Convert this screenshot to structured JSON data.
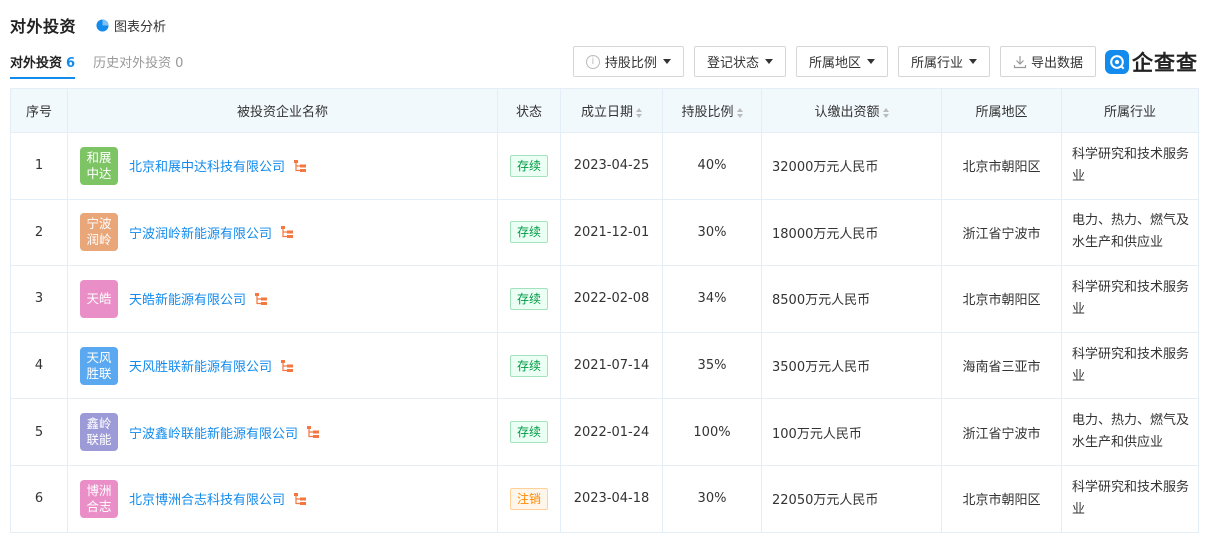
{
  "header": {
    "title": "对外投资",
    "chart_link": "图表分析"
  },
  "tabs": [
    {
      "label": "对外投资",
      "count": "6"
    },
    {
      "label": "历史对外投资",
      "count": "0"
    }
  ],
  "toolbar": {
    "share_ratio": "持股比例",
    "reg_status": "登记状态",
    "region": "所属地区",
    "industry": "所属行业",
    "export": "导出数据"
  },
  "brand": {
    "name": "企查查"
  },
  "colors": {
    "accent": "#128bed",
    "status_ok": "#009944",
    "status_cancel": "#ff8900"
  },
  "table": {
    "columns": {
      "index": "序号",
      "name": "被投资企业名称",
      "status": "状态",
      "date": "成立日期",
      "ratio": "持股比例",
      "capital": "认缴出资额",
      "region": "所属地区",
      "industry": "所属行业"
    },
    "rows": [
      {
        "index": "1",
        "avatar": "和展中达",
        "avatar_color": "#7dc465",
        "name": "北京和展中达科技有限公司",
        "status": "存续",
        "status_type": "ok",
        "date": "2023-04-25",
        "ratio": "40%",
        "capital": "32000万元人民币",
        "region": "北京市朝阳区",
        "industry": "科学研究和技术服务业"
      },
      {
        "index": "2",
        "avatar": "宁波润岭",
        "avatar_color": "#e8a679",
        "name": "宁波润岭新能源有限公司",
        "status": "存续",
        "status_type": "ok",
        "date": "2021-12-01",
        "ratio": "30%",
        "capital": "18000万元人民币",
        "region": "浙江省宁波市",
        "industry": "电力、热力、燃气及水生产和供应业"
      },
      {
        "index": "3",
        "avatar": "天皓",
        "avatar_color": "#ea8ec7",
        "name": "天皓新能源有限公司",
        "status": "存续",
        "status_type": "ok",
        "date": "2022-02-08",
        "ratio": "34%",
        "capital": "8500万元人民币",
        "region": "北京市朝阳区",
        "industry": "科学研究和技术服务业"
      },
      {
        "index": "4",
        "avatar": "天风胜联",
        "avatar_color": "#5aa9f0",
        "name": "天风胜联新能源有限公司",
        "status": "存续",
        "status_type": "ok",
        "date": "2021-07-14",
        "ratio": "35%",
        "capital": "3500万元人民币",
        "region": "海南省三亚市",
        "industry": "科学研究和技术服务业"
      },
      {
        "index": "5",
        "avatar": "鑫岭联能",
        "avatar_color": "#9d9ad8",
        "name": "宁波鑫岭联能新能源有限公司",
        "status": "存续",
        "status_type": "ok",
        "date": "2022-01-24",
        "ratio": "100%",
        "capital": "100万元人民币",
        "region": "浙江省宁波市",
        "industry": "电力、热力、燃气及水生产和供应业"
      },
      {
        "index": "6",
        "avatar": "博洲合志",
        "avatar_color": "#ea8ec7",
        "name": "北京博洲合志科技有限公司",
        "status": "注销",
        "status_type": "cancel",
        "date": "2023-04-18",
        "ratio": "30%",
        "capital": "22050万元人民币",
        "region": "北京市朝阳区",
        "industry": "科学研究和技术服务业"
      }
    ]
  }
}
